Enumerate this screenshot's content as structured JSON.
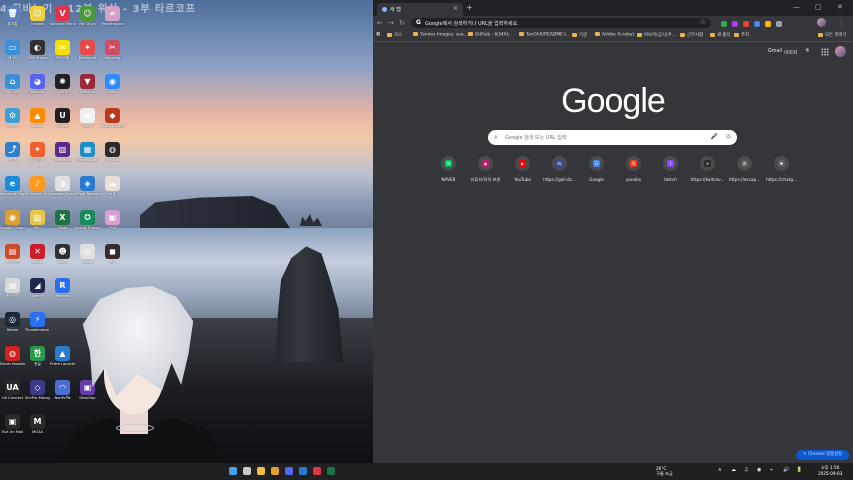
{
  "desktop": {
    "top_caption": "4   모바노기 - 12부 워쉬 - 3부 타르코프",
    "icons": [
      {
        "label": "휴지통",
        "color": "#5b7fbf",
        "glyph": "🗑",
        "col": 0,
        "row": 0
      },
      {
        "label": "내 PC",
        "color": "#3a8fd6",
        "glyph": "▭",
        "col": 0,
        "row": 1
      },
      {
        "label": "네트워크",
        "color": "#3a8fd6",
        "glyph": "⌂",
        "col": 0,
        "row": 2
      },
      {
        "label": "제어판",
        "color": "#3aa0d6",
        "glyph": "⚙",
        "col": 0,
        "row": 3
      },
      {
        "label": "원격",
        "color": "#2d7fd0",
        "glyph": "⤴",
        "col": 0,
        "row": 4
      },
      {
        "label": "Microsoft Edge",
        "color": "#1e8bd8",
        "glyph": "e",
        "col": 0,
        "row": 5
      },
      {
        "label": "Google Chrome",
        "color": "#e0a030",
        "glyph": "◉",
        "col": 0,
        "row": 6
      },
      {
        "label": "문서작업",
        "color": "#d04a2a",
        "glyph": "▤",
        "col": 0,
        "row": 7
      },
      {
        "label": "문서작업",
        "color": "#d8d8d8",
        "glyph": "▤",
        "col": 0,
        "row": 8
      },
      {
        "label": "Steam",
        "color": "#1b2838",
        "glyph": "◎",
        "col": 0,
        "row": 9
      },
      {
        "label": "Driver Booster 12",
        "color": "#d02020",
        "glyph": "◍",
        "col": 0,
        "row": 10
      },
      {
        "label": "UA Connect",
        "color": "#2a2a2a",
        "glyph": "UA",
        "col": 0,
        "row": 11
      },
      {
        "label": "EsX Un Mail",
        "color": "#2a2a2a",
        "glyph": "▣",
        "col": 0,
        "row": 12
      },
      {
        "label": "inkwell",
        "color": "#f0d040",
        "glyph": "☺",
        "col": 1,
        "row": 0
      },
      {
        "label": "OBS Studio",
        "color": "#303030",
        "glyph": "◐",
        "col": 1,
        "row": 1
      },
      {
        "label": "Discord",
        "color": "#5865f2",
        "glyph": "◕",
        "col": 1,
        "row": 2
      },
      {
        "label": "Adobe",
        "color": "#ff8a00",
        "glyph": "▲",
        "col": 1,
        "row": 3
      },
      {
        "label": "나무위키",
        "color": "#f06030",
        "glyph": "✦",
        "col": 1,
        "row": 4
      },
      {
        "label": "FL Studio 2024",
        "color": "#ff9a1f",
        "glyph": "♪",
        "col": 1,
        "row": 5
      },
      {
        "label": "MIC",
        "color": "#e8c84a",
        "glyph": "▥",
        "col": 1,
        "row": 6
      },
      {
        "label": "Edius",
        "color": "#c81e2a",
        "glyph": "✕",
        "col": 1,
        "row": 7
      },
      {
        "label": "OpenVR",
        "color": "#202850",
        "glyph": "◢",
        "col": 1,
        "row": 8
      },
      {
        "label": "Thunderstore Mod Mana...",
        "color": "#2a6ff0",
        "glyph": "⚡",
        "col": 1,
        "row": 9
      },
      {
        "label": "한글",
        "color": "#2a9a4a",
        "glyph": "한",
        "col": 1,
        "row": 10
      },
      {
        "label": "SimPro Manager",
        "color": "#3a3a8a",
        "glyph": "◇",
        "col": 1,
        "row": 11
      },
      {
        "label": "MOZA",
        "color": "#2a2a2a",
        "glyph": "M",
        "col": 1,
        "row": 12
      },
      {
        "label": "Valorant Manager",
        "color": "#e0334a",
        "glyph": "V",
        "col": 2,
        "row": 0
      },
      {
        "label": "카카오톡",
        "color": "#f9e000",
        "glyph": "✉",
        "col": 2,
        "row": 1
      },
      {
        "label": "ChatGPT",
        "color": "#202020",
        "glyph": "✺",
        "col": 2,
        "row": 2
      },
      {
        "label": "Unreal",
        "color": "#202020",
        "glyph": "U",
        "col": 2,
        "row": 3
      },
      {
        "label": "Wallpaper",
        "color": "#5a2a8a",
        "glyph": "▧",
        "col": 2,
        "row": 4
      },
      {
        "label": "Lossless Scaling",
        "color": "#e0e0e0",
        "glyph": "◑",
        "col": 2,
        "row": 5
      },
      {
        "label": "Excel",
        "color": "#1f7244",
        "glyph": "X",
        "col": 2,
        "row": 6
      },
      {
        "label": "MixIT",
        "color": "#303030",
        "glyph": "☻",
        "col": 2,
        "row": 7
      },
      {
        "label": "Reamer",
        "color": "#2a6ff0",
        "glyph": "R",
        "col": 2,
        "row": 8
      },
      {
        "label": "Prism Launcher",
        "color": "#2a7ad0",
        "glyph": "▲",
        "col": 2,
        "row": 10
      },
      {
        "label": "NordVPN",
        "color": "#4a6fd0",
        "glyph": "◠",
        "col": 2,
        "row": 11
      },
      {
        "label": "Fall Guys",
        "color": "#4a9a3a",
        "glyph": "☺",
        "col": 3,
        "row": 0
      },
      {
        "label": "Battle.net",
        "color": "#e84a4a",
        "glyph": "✦",
        "col": 3,
        "row": 1
      },
      {
        "label": "Winamp",
        "color": "#9a2a3a",
        "glyph": "▼",
        "col": 3,
        "row": 2
      },
      {
        "label": "메모장",
        "color": "#f0f0f0",
        "glyph": "▤",
        "col": 3,
        "row": 3
      },
      {
        "label": "Stream Deck",
        "color": "#1e90c8",
        "glyph": "▦",
        "col": 3,
        "row": 4
      },
      {
        "label": "XSplit Broadcaster",
        "color": "#2a7ad0",
        "glyph": "◈",
        "col": 3,
        "row": 5
      },
      {
        "label": "Sea of Thieves",
        "color": "#1a8a5a",
        "glyph": "✪",
        "col": 3,
        "row": 6
      },
      {
        "label": "Voice",
        "color": "#e0e0e0",
        "glyph": "◎",
        "col": 3,
        "row": 7
      },
      {
        "label": "DeskGap",
        "color": "#6a3aaa",
        "glyph": "▣",
        "col": 3,
        "row": 11
      },
      {
        "label": "Hearthstone",
        "color": "#d8a0c8",
        "glyph": "☙",
        "col": 4,
        "row": 0
      },
      {
        "label": "Snipping",
        "color": "#d04a60",
        "glyph": "✂",
        "col": 4,
        "row": 1
      },
      {
        "label": "Zoom",
        "color": "#2d8cff",
        "glyph": "◉",
        "col": 4,
        "row": 2
      },
      {
        "label": "MOBA LEGENDS",
        "color": "#b83a1a",
        "glyph": "◆",
        "col": 4,
        "row": 3
      },
      {
        "label": "VRChat",
        "color": "#2a2a2a",
        "glyph": "◍",
        "col": 4,
        "row": 4
      },
      {
        "label": "녹음",
        "color": "#e8e0d8",
        "glyph": "☁",
        "col": 4,
        "row": 5
      },
      {
        "label": "PS5",
        "color": "#d8a0d0",
        "glyph": "▣",
        "col": 4,
        "row": 6
      },
      {
        "label": "PC",
        "color": "#3a2a2a",
        "glyph": "◼",
        "col": 4,
        "row": 7
      }
    ]
  },
  "chrome": {
    "tab": {
      "title": "새 탭",
      "close": "×"
    },
    "new_tab": "+",
    "window_controls": {
      "minimize": "—",
      "maximize": "▢",
      "close": "✕"
    },
    "nav": {
      "back": "←",
      "forward": "→",
      "reload": "↻"
    },
    "omnibox": {
      "g": "G",
      "placeholder": "Google에서 검색하거나 URL을 입력하세요.",
      "star": "☆"
    },
    "extensions": [
      {
        "name": "ext-green",
        "color": "#34a853"
      },
      {
        "name": "ext-purple",
        "color": "#a142f4"
      },
      {
        "name": "ext-red",
        "color": "#ea4335"
      },
      {
        "name": "ext-blue",
        "color": "#4285f4"
      },
      {
        "name": "ext-orange",
        "color": "#fbbc04"
      },
      {
        "name": "ext-gray",
        "color": "#9aa0a6"
      }
    ],
    "bookmarks": [
      {
        "label": "가스"
      },
      {
        "label": "Yandex Images: sea..."
      },
      {
        "label": "GitHub - tt34/tt..."
      },
      {
        "label": "TanGhX/README t..."
      },
      {
        "label": "기글"
      },
      {
        "label": "Adobe Acrobat"
      },
      {
        "label": "아보카(공식)쿠..."
      },
      {
        "label": "근무사항"
      },
      {
        "label": "새 폴더"
      },
      {
        "label": "주차"
      }
    ],
    "other_bookmarks": "모든 북마크",
    "top_links": {
      "gmail": "Gmail",
      "images": "이미지"
    },
    "logo": "Google",
    "search": {
      "icon": "⌕",
      "placeholder": "Google 검색 또는 URL 입력",
      "mic": "🎤",
      "lens": "◎"
    },
    "shortcuts": [
      {
        "label": "NAVER",
        "color": "#03c75a",
        "glyph": "N"
      },
      {
        "label": "유튜브/뮤직 보관",
        "color": "#c01a6a",
        "glyph": "◉"
      },
      {
        "label": "YouTube",
        "color": "#ff0000",
        "glyph": "▶"
      },
      {
        "label": "https://gall.dc...",
        "color": "#3b4890",
        "glyph": "dc"
      },
      {
        "label": "Google",
        "color": "#4285f4",
        "glyph": "G"
      },
      {
        "label": "yandex",
        "color": "#fc3f1d",
        "glyph": "Я"
      },
      {
        "label": "twitch",
        "color": "#9146ff",
        "glyph": "t"
      },
      {
        "label": "https://twitcev...",
        "color": "#2a2a2a",
        "glyph": "✕"
      },
      {
        "label": "https://escap...",
        "color": "#606060",
        "glyph": "⚙"
      },
      {
        "label": "https://chatg...",
        "color": "#606060",
        "glyph": "✺"
      }
    ],
    "customize": "✎ Chrome 맞춤설정"
  },
  "taskbar": {
    "pinned": [
      {
        "name": "start",
        "color": "#4aa0f0"
      },
      {
        "name": "search",
        "color": "#c8c8c8"
      },
      {
        "name": "explorer",
        "color": "#f0c040"
      },
      {
        "name": "chrome",
        "color": "#e0a030"
      },
      {
        "name": "discord",
        "color": "#5865f2"
      },
      {
        "name": "ms-store",
        "color": "#2a7ad0"
      },
      {
        "name": "valorant",
        "color": "#e0334a"
      },
      {
        "name": "excel",
        "color": "#1f7244"
      }
    ],
    "weather": {
      "temp": "26°C",
      "desc": "구름 조금"
    },
    "tray_icons": [
      "∧",
      "☁",
      "♫",
      "◉",
      "⌁",
      "🔊",
      "🔋"
    ],
    "clock": {
      "time": "오후 1:56",
      "date": "2025-09-03"
    }
  }
}
